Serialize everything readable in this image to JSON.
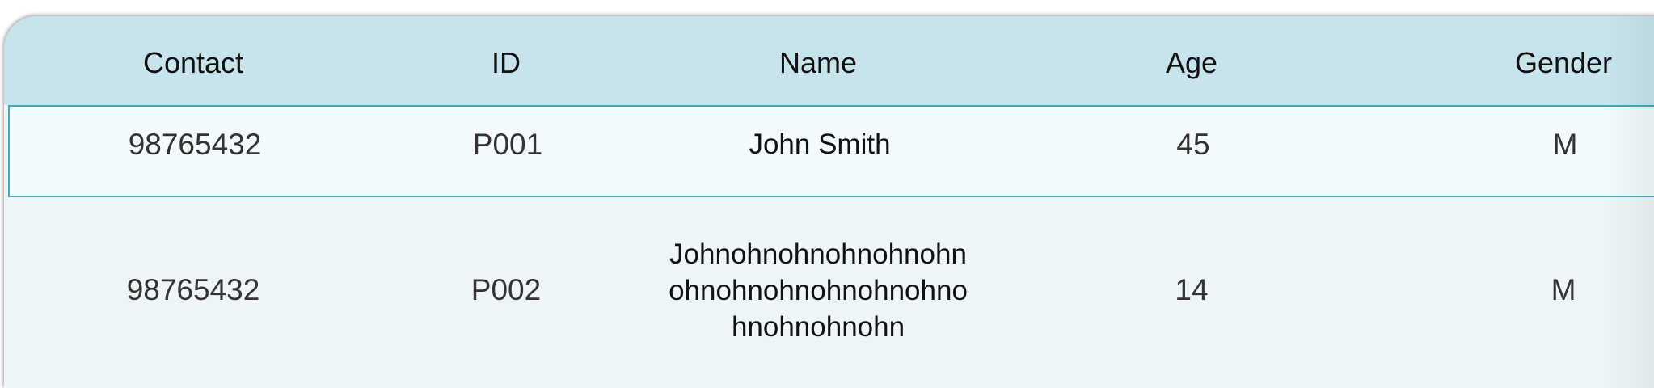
{
  "table": {
    "headers": [
      "Contact",
      "ID",
      "Name",
      "Age",
      "Gender"
    ],
    "rows": [
      {
        "contact": "98765432",
        "id": "P001",
        "name": [
          "John Smith"
        ],
        "age": "45",
        "gender": "M",
        "selected": true
      },
      {
        "contact": "98765432",
        "id": "P002",
        "name": [
          "Johnohnohnohnohnohn",
          "ohnohnohnohnohnohno",
          "hnohnohnohn"
        ],
        "age": "14",
        "gender": "M",
        "selected": false
      }
    ]
  },
  "colors": {
    "header_bg": "#c7e4ec",
    "row_selected_bg": "#f3fafc",
    "row_selected_border": "#3fa9bd",
    "row_bg": "#eef5f7"
  }
}
